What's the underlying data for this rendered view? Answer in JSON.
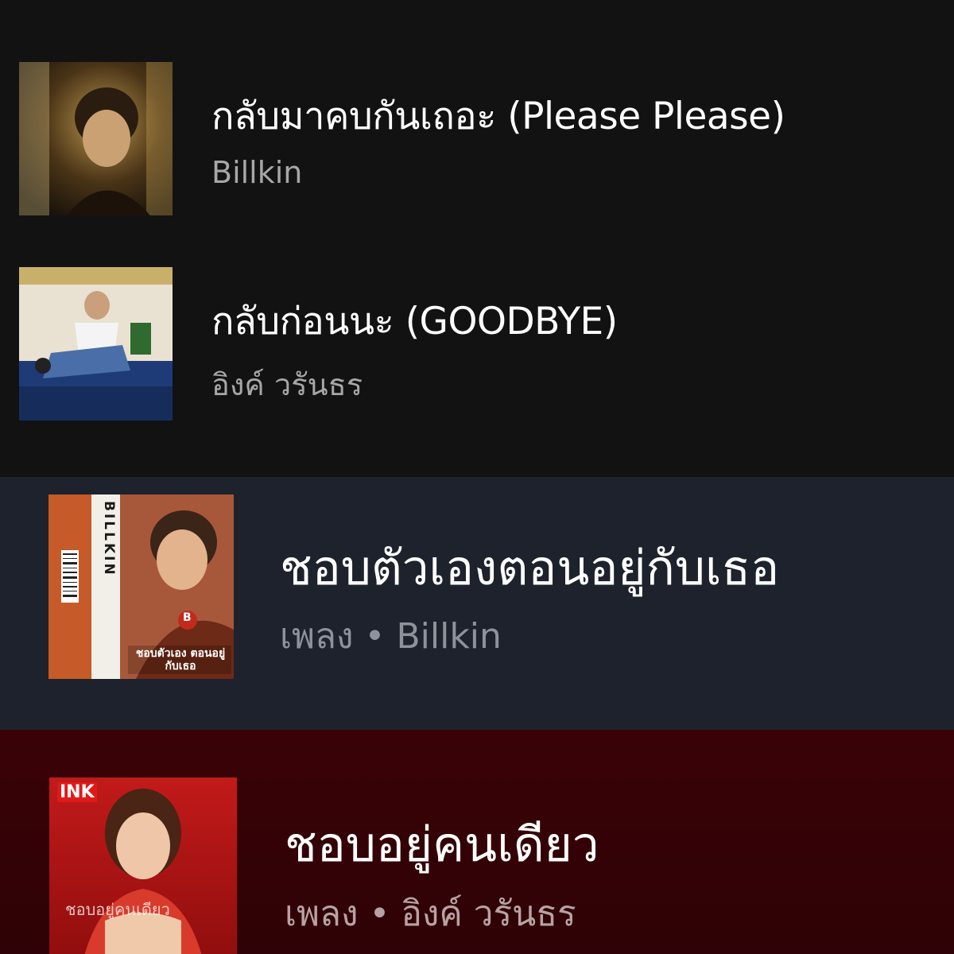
{
  "recent_list": {
    "items": [
      {
        "title": "กลับมาคบกันเถอะ (Please Please)",
        "subtitle": "Billkin"
      },
      {
        "title": "กลับก่อนนะ (GOODBYE)",
        "subtitle": "อิงค์ วรันธร"
      }
    ]
  },
  "song_cards": [
    {
      "title": "ชอบตัวเองตอนอยู่กับเธอ",
      "type_label": "เพลง",
      "separator": "•",
      "artist": "Billkin",
      "cover_text": {
        "spine": "BILLKIN",
        "badge": "B",
        "cover_title": "ชอบตัวเอง ตอนอยู่กับเธอ"
      }
    },
    {
      "title": "ชอบอยู่คนเดียว",
      "type_label": "เพลง",
      "separator": "•",
      "artist": "อิงค์ วรันธร",
      "cover_text": {
        "logo": "INK",
        "cover_title": "ชอบอยู่คนเดียว"
      }
    }
  ],
  "colors": {
    "list_bg": "#121212",
    "card1_bg": "#1d222c",
    "card2_bg": "#3a0206",
    "text_primary": "#ffffff",
    "text_secondary": "#a7a7a7"
  }
}
